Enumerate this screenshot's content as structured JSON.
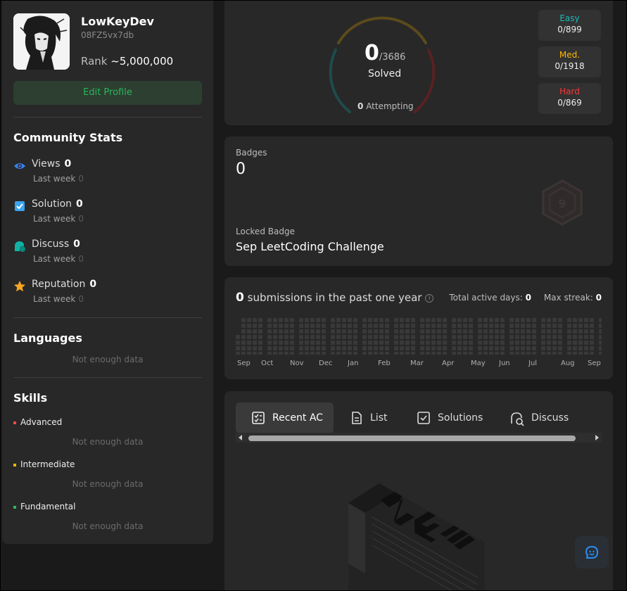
{
  "profile": {
    "username": "LowKeyDev",
    "user_id": "08FZ5vx7db",
    "rank_label": "Rank",
    "rank_value": "~5,000,000",
    "edit_label": "Edit Profile"
  },
  "community": {
    "title": "Community Stats",
    "items": [
      {
        "name": "Views",
        "value": "0",
        "last_week_label": "Last week",
        "last_week": "0",
        "icon": "eye-icon",
        "color": "#3b82f6"
      },
      {
        "name": "Solution",
        "value": "0",
        "last_week_label": "Last week",
        "last_week": "0",
        "icon": "check-square-icon",
        "color": "#3ba4f0"
      },
      {
        "name": "Discuss",
        "value": "0",
        "last_week_label": "Last week",
        "last_week": "0",
        "icon": "discuss-icon",
        "color": "#10b3a3"
      },
      {
        "name": "Reputation",
        "value": "0",
        "last_week_label": "Last week",
        "last_week": "0",
        "icon": "star-icon",
        "color": "#f5a623"
      }
    ]
  },
  "languages": {
    "title": "Languages",
    "empty": "Not enough data"
  },
  "skills": {
    "title": "Skills",
    "items": [
      {
        "name": "Advanced",
        "empty": "Not enough data",
        "color": "#ef4743"
      },
      {
        "name": "Intermediate",
        "empty": "Not enough data",
        "color": "#ffb800"
      },
      {
        "name": "Fundamental",
        "empty": "Not enough data",
        "color": "#2cbb5d"
      }
    ]
  },
  "solved": {
    "count": "0",
    "total": "/3686",
    "label": "Solved",
    "attempting_count": "0",
    "attempting_label": "Attempting",
    "difficulties": [
      {
        "label": "Easy",
        "value": "0/899",
        "color": "#1cbaba"
      },
      {
        "label": "Med.",
        "value": "0/1918",
        "color": "#ffb700"
      },
      {
        "label": "Hard",
        "value": "0/869",
        "color": "#f63737"
      }
    ]
  },
  "badges": {
    "title": "Badges",
    "count": "0",
    "locked_label": "Locked Badge",
    "locked_name": "Sep LeetCoding Challenge"
  },
  "submissions": {
    "count": "0",
    "label": "submissions in the past one year",
    "active_days_label": "Total active days:",
    "active_days": "0",
    "max_streak_label": "Max streak:",
    "max_streak": "0",
    "months": [
      "Sep",
      "Oct",
      "Nov",
      "Dec",
      "Jan",
      "Feb",
      "Mar",
      "Apr",
      "May",
      "Jun",
      "Jul",
      "Aug",
      "Sep"
    ]
  },
  "tabs": {
    "items": [
      {
        "label": "Recent AC",
        "icon": "recent-ac-icon"
      },
      {
        "label": "List",
        "icon": "list-icon"
      },
      {
        "label": "Solutions",
        "icon": "solutions-icon"
      },
      {
        "label": "Discuss",
        "icon": "discuss-search-icon"
      }
    ],
    "active": "Recent AC"
  },
  "accent": {
    "green": "#2db55d",
    "blue": "#2a8df3"
  }
}
